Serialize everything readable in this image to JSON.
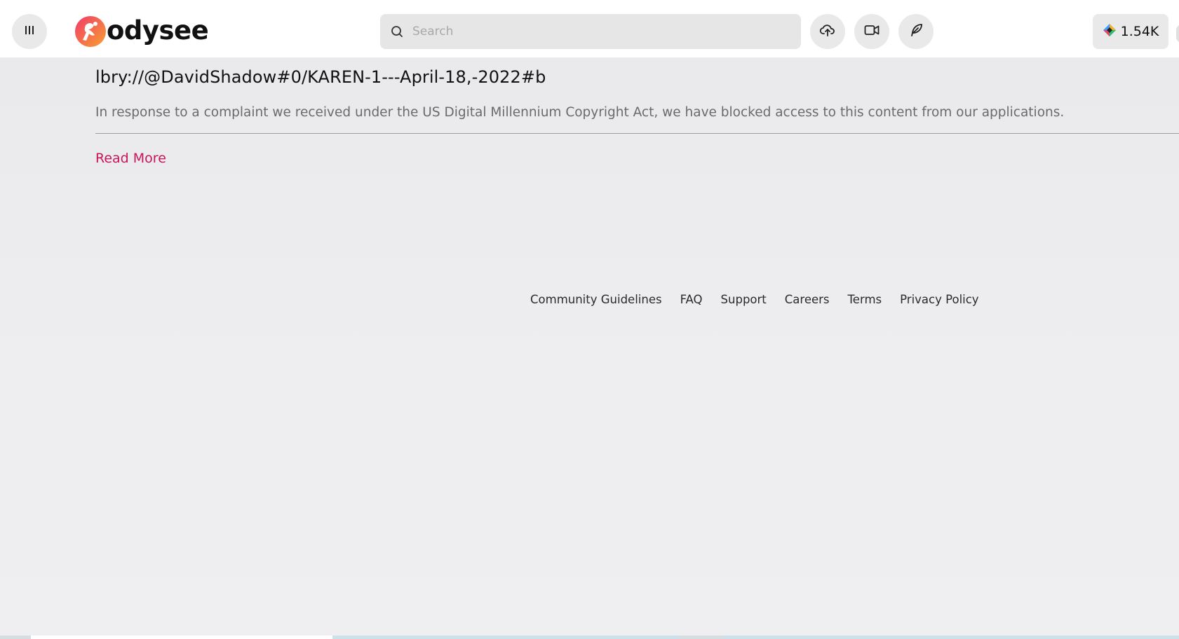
{
  "header": {
    "logo_text": "odysee",
    "search": {
      "placeholder": "Search",
      "value": ""
    },
    "wallet": {
      "amount": "1.54K"
    },
    "icons": {
      "menu": "menu-icon",
      "search": "search-icon",
      "upload": "cloud-upload-icon",
      "golive": "video-camera-icon",
      "post": "feather-icon",
      "wallet": "lbc-credits-icon"
    }
  },
  "main": {
    "claim_url": "lbry://@DavidShadow#0/KAREN-1---April-18,-2022#b",
    "message": "In response to a complaint we received under the US Digital Millennium Copyright Act, we have blocked access to this content from our applications.",
    "read_more_label": "Read More"
  },
  "footer": {
    "links": [
      "Community Guidelines",
      "FAQ",
      "Support",
      "Careers",
      "Terms",
      "Privacy Policy"
    ]
  },
  "colors": {
    "accent": "#c7155a",
    "background": "#ececee",
    "header_bg": "#ffffff",
    "button_bg": "#e9e9e9"
  }
}
